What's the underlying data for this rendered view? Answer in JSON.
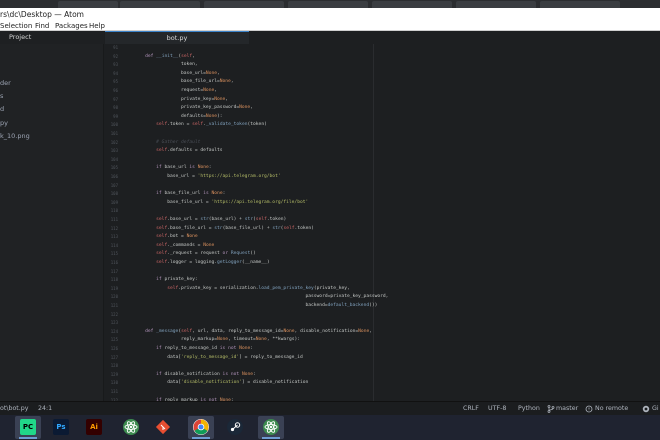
{
  "window": {
    "title": "rs\\dc\\Desktop — Atom"
  },
  "menu": {
    "items": [
      "Selection",
      "Find",
      "Packages",
      "Help"
    ]
  },
  "tree_view": {
    "title": "Project",
    "items": [
      "der",
      "s",
      "d",
      "py",
      "k_10.png"
    ]
  },
  "editor": {
    "active_tab": "bot.py",
    "lines": [
      {
        "n": "91",
        "html": ""
      },
      {
        "n": "92",
        "html": "    <span class=\"kw\">def</span> <span class=\"fn\">__init__</span>(<span class=\"self\">self</span>,"
      },
      {
        "n": "93",
        "html": "                 token,"
      },
      {
        "n": "94",
        "html": "                 base_url=<span class=\"num\">None</span>,"
      },
      {
        "n": "95",
        "html": "                 base_file_url=<span class=\"num\">None</span>,"
      },
      {
        "n": "96",
        "html": "                 request=<span class=\"num\">None</span>,"
      },
      {
        "n": "97",
        "html": "                 private_key=<span class=\"num\">None</span>,"
      },
      {
        "n": "98",
        "html": "                 private_key_password=<span class=\"num\">None</span>,"
      },
      {
        "n": "99",
        "html": "                 defaults=<span class=\"num\">None</span>):"
      },
      {
        "n": "100",
        "html": "        <span class=\"self\">self</span>.token = <span class=\"self\">self</span>.<span class=\"fn\">_validate_token</span>(token)"
      },
      {
        "n": "101",
        "html": ""
      },
      {
        "n": "102",
        "html": "        <span class=\"cmt\"># Gather default</span>"
      },
      {
        "n": "103",
        "html": "        <span class=\"self\">self</span>.defaults = defaults"
      },
      {
        "n": "104",
        "html": ""
      },
      {
        "n": "105",
        "html": "        <span class=\"kw\">if</span> base_url <span class=\"kw\">is</span> <span class=\"num\">None</span>:"
      },
      {
        "n": "106",
        "html": "            base_url = <span class=\"str\">'https://api.telegram.org/bot'</span>"
      },
      {
        "n": "107",
        "html": ""
      },
      {
        "n": "108",
        "html": "        <span class=\"kw\">if</span> base_file_url <span class=\"kw\">is</span> <span class=\"num\">None</span>:"
      },
      {
        "n": "109",
        "html": "            base_file_url = <span class=\"str\">'https://api.telegram.org/file/bot'</span>"
      },
      {
        "n": "110",
        "html": ""
      },
      {
        "n": "111",
        "html": "        <span class=\"self\">self</span>.base_url = <span class=\"fn\">str</span>(base_url) + <span class=\"fn\">str</span>(<span class=\"self\">self</span>.token)"
      },
      {
        "n": "112",
        "html": "        <span class=\"self\">self</span>.base_file_url = <span class=\"fn\">str</span>(base_file_url) + <span class=\"fn\">str</span>(<span class=\"self\">self</span>.token)"
      },
      {
        "n": "113",
        "html": "        <span class=\"self\">self</span>.bot = <span class=\"num\">None</span>"
      },
      {
        "n": "114",
        "html": "        <span class=\"self\">self</span>._commands = <span class=\"num\">None</span>"
      },
      {
        "n": "115",
        "html": "        <span class=\"self\">self</span>._request = request <span class=\"kw\">or</span> <span class=\"fn\">Request</span>()"
      },
      {
        "n": "116",
        "html": "        <span class=\"self\">self</span>.logger = logging.<span class=\"fn\">getLogger</span>(__name__)"
      },
      {
        "n": "117",
        "html": ""
      },
      {
        "n": "118",
        "html": "        <span class=\"kw\">if</span> private_key:"
      },
      {
        "n": "119",
        "html": "            <span class=\"self\">self</span>.private_key = serialization.<span class=\"fn\">load_pem_private_key</span>(private_key,"
      },
      {
        "n": "120",
        "html": "                                                              password=private_key_password,"
      },
      {
        "n": "121",
        "html": "                                                              backend=<span class=\"fn\">default_backend</span>())"
      },
      {
        "n": "122",
        "html": ""
      },
      {
        "n": "123",
        "html": ""
      },
      {
        "n": "124",
        "html": "    <span class=\"kw\">def</span> <span class=\"fn\">_message</span>(<span class=\"self\">self</span>, url, data, reply_to_message_id=<span class=\"num\">None</span>, disable_notification=<span class=\"num\">None</span>,"
      },
      {
        "n": "125",
        "html": "                 reply_markup=<span class=\"num\">None</span>, timeout=<span class=\"num\">None</span>, **kwargs):"
      },
      {
        "n": "126",
        "html": "        <span class=\"kw\">if</span> reply_to_message_id <span class=\"kw\">is not</span> <span class=\"num\">None</span>:"
      },
      {
        "n": "127",
        "html": "            data[<span class=\"str\">'reply_to_message_id'</span>] = reply_to_message_id"
      },
      {
        "n": "128",
        "html": ""
      },
      {
        "n": "129",
        "html": "        <span class=\"kw\">if</span> disable_notification <span class=\"kw\">is not</span> <span class=\"num\">None</span>:"
      },
      {
        "n": "130",
        "html": "            data[<span class=\"str\">'disable_notification'</span>] = disable_notification"
      },
      {
        "n": "131",
        "html": ""
      },
      {
        "n": "132",
        "html": "        <span class=\"kw\">if</span> reply_markup <span class=\"kw\">is not</span> <span class=\"num\">None</span>:"
      },
      {
        "n": "133",
        "html": "            <span class=\"kw\">if</span> <span class=\"fn\">isinstance</span>(reply_markup, ReplyMarkup):"
      }
    ]
  },
  "status_bar": {
    "file_path": "ot\\bot.py",
    "cursor": "24:1",
    "line_ending": "CRLF",
    "encoding": "UTF-8",
    "grammar": "Python",
    "branch": "master",
    "remote": "No remote",
    "github": "Gi"
  },
  "taskbar": {
    "apps": [
      {
        "name": "pycharm-icon",
        "label": "PC",
        "bg": "#21d789",
        "fg": "#000000",
        "active": true
      },
      {
        "name": "photoshop-icon",
        "label": "Ps",
        "bg": "#0b1a33",
        "fg": "#31a8ff",
        "active": false
      },
      {
        "name": "illustrator-icon",
        "label": "Ai",
        "bg": "#330000",
        "fg": "#ff9a00",
        "active": false
      },
      {
        "name": "atom-icon",
        "label": "",
        "bg": "#66595c",
        "fg": "#ffffff",
        "active": false
      },
      {
        "name": "git-icon",
        "label": "",
        "bg": "#e3e3e3",
        "fg": "#000000",
        "active": false
      },
      {
        "name": "chrome-icon",
        "label": "",
        "bg": "#ffffff",
        "fg": "#000000",
        "active": true
      },
      {
        "name": "steam-icon",
        "label": "",
        "bg": "#1b2838",
        "fg": "#ffffff",
        "active": false
      },
      {
        "name": "atom-icon-2",
        "label": "",
        "bg": "#66595c",
        "fg": "#ffffff",
        "active": true
      }
    ]
  },
  "colors": {
    "editor_bg": "#1d1f21",
    "tree_bg": "#202224",
    "taskbar_bg": "#1f2330",
    "tab_accent": "#3b82c8"
  }
}
